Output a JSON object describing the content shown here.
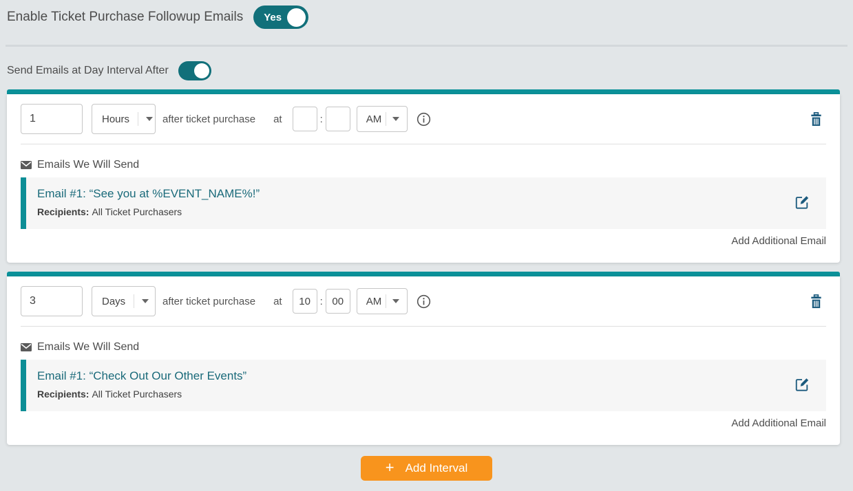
{
  "header": {
    "title": "Enable Ticket Purchase Followup Emails",
    "toggle": {
      "label": "Yes",
      "state": "on"
    }
  },
  "interval_mode": {
    "label": "Send Emails at Day Interval After",
    "toggle_state": "on"
  },
  "labels": {
    "after_ticket_purchase": "after ticket purchase",
    "at": "at",
    "colon": ":",
    "emails_header": "Emails We Will Send",
    "recipients_label": "Recipients:",
    "add_additional_email": "Add Additional Email"
  },
  "intervals": [
    {
      "value": "1",
      "unit": "Hours",
      "hour": "",
      "minute": "",
      "ampm": "AM",
      "email": {
        "title": "Email #1: “See you at %EVENT_NAME%!”",
        "recipients": "All Ticket Purchasers"
      }
    },
    {
      "value": "3",
      "unit": "Days",
      "hour": "10",
      "minute": "00",
      "ampm": "AM",
      "email": {
        "title": "Email #1: “Check Out Our Other Events”",
        "recipients": "All Ticket Purchasers"
      }
    }
  ],
  "footer": {
    "add_interval_label": "Add Interval",
    "plus": "+"
  },
  "colors": {
    "teal_bar": "#0b9199",
    "toggle_teal": "#11707a",
    "icon_blue": "#1b5a7d",
    "button_orange": "#f8941d",
    "email_title_teal": "#1a6a7a"
  }
}
